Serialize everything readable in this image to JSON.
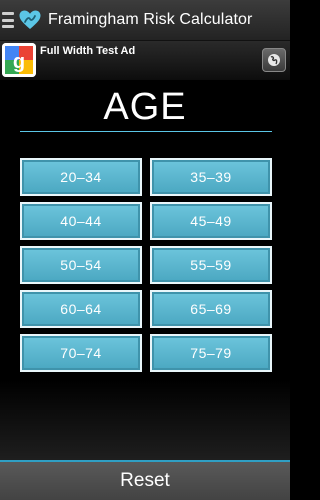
{
  "app": {
    "title": "Framingham Risk Calculator",
    "accent_color": "#5bc6e6"
  },
  "ad": {
    "text": "Full Width Test Ad",
    "logo_icon": "google-logo-icon",
    "globe_icon": "globe-icon"
  },
  "page": {
    "heading": "AGE"
  },
  "age_buttons": [
    {
      "label": "20–34"
    },
    {
      "label": "35–39"
    },
    {
      "label": "40–44"
    },
    {
      "label": "45–49"
    },
    {
      "label": "50–54"
    },
    {
      "label": "55–59"
    },
    {
      "label": "60–64"
    },
    {
      "label": "65–69"
    },
    {
      "label": "70–74"
    },
    {
      "label": "75–79"
    }
  ],
  "footer": {
    "reset_label": "Reset"
  }
}
